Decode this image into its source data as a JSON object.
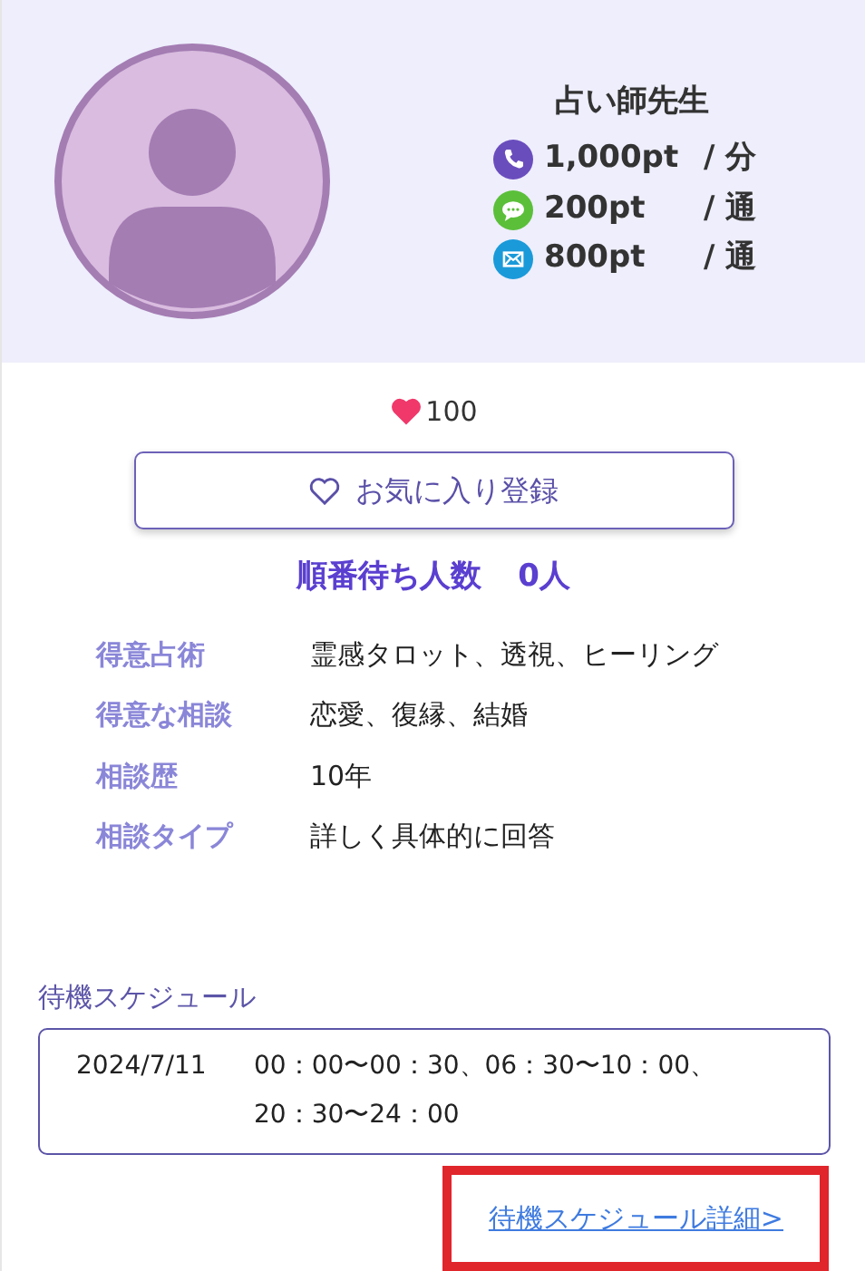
{
  "profile": {
    "name": "占い師先生",
    "rates": [
      {
        "kind": "phone",
        "price": "1,000pt",
        "unit": "/ 分"
      },
      {
        "kind": "chat",
        "price": "200pt",
        "unit": "/ 通"
      },
      {
        "kind": "mail",
        "price": "800pt",
        "unit": "/ 通"
      }
    ]
  },
  "likes": "100",
  "favorite_button": "お気に入り登録",
  "queue": {
    "label": "順番待ち人数",
    "count": "0人"
  },
  "details": [
    {
      "label": "得意占術",
      "value": "霊感タロット、透視、ヒーリング"
    },
    {
      "label": "得意な相談",
      "value": "恋愛、復縁、結婚"
    },
    {
      "label": "相談歴",
      "value": "10年"
    },
    {
      "label": "相談タイプ",
      "value": "詳しく具体的に回答"
    }
  ],
  "schedule": {
    "title": "待機スケジュール",
    "entries": [
      {
        "date": "2024/7/11",
        "lines": [
          "00：00〜00：30、06：30〜10：00、",
          "20：30〜24：00"
        ]
      }
    ]
  },
  "detail_link": {
    "text": "待機スケジュール詳細>",
    "highlighted": true
  }
}
